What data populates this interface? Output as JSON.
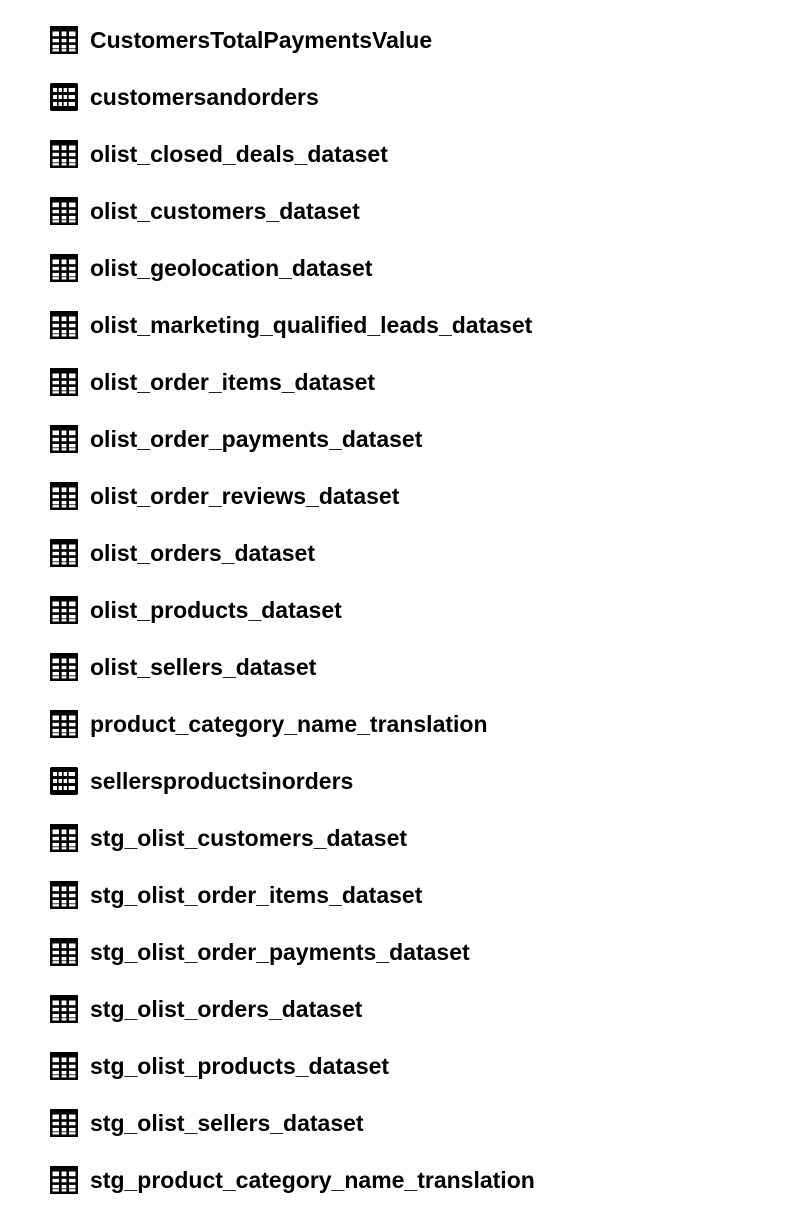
{
  "resources": [
    {
      "label": "CustomersTotalPaymentsValue",
      "icon": "table-icon",
      "type": "table"
    },
    {
      "label": "customersandorders",
      "icon": "view-icon",
      "type": "view"
    },
    {
      "label": "olist_closed_deals_dataset",
      "icon": "table-icon",
      "type": "table"
    },
    {
      "label": "olist_customers_dataset",
      "icon": "table-icon",
      "type": "table"
    },
    {
      "label": "olist_geolocation_dataset",
      "icon": "table-icon",
      "type": "table"
    },
    {
      "label": "olist_marketing_qualified_leads_dataset",
      "icon": "table-icon",
      "type": "table"
    },
    {
      "label": "olist_order_items_dataset",
      "icon": "table-icon",
      "type": "table"
    },
    {
      "label": "olist_order_payments_dataset",
      "icon": "table-icon",
      "type": "table"
    },
    {
      "label": "olist_order_reviews_dataset",
      "icon": "table-icon",
      "type": "table"
    },
    {
      "label": "olist_orders_dataset",
      "icon": "table-icon",
      "type": "table"
    },
    {
      "label": "olist_products_dataset",
      "icon": "table-icon",
      "type": "table"
    },
    {
      "label": "olist_sellers_dataset",
      "icon": "table-icon",
      "type": "table"
    },
    {
      "label": "product_category_name_translation",
      "icon": "table-icon",
      "type": "table"
    },
    {
      "label": "sellersproductsinorders",
      "icon": "view-icon",
      "type": "view"
    },
    {
      "label": "stg_olist_customers_dataset",
      "icon": "table-icon",
      "type": "table"
    },
    {
      "label": "stg_olist_order_items_dataset",
      "icon": "table-icon",
      "type": "table"
    },
    {
      "label": "stg_olist_order_payments_dataset",
      "icon": "table-icon",
      "type": "table"
    },
    {
      "label": "stg_olist_orders_dataset",
      "icon": "table-icon",
      "type": "table"
    },
    {
      "label": "stg_olist_products_dataset",
      "icon": "table-icon",
      "type": "table"
    },
    {
      "label": "stg_olist_sellers_dataset",
      "icon": "table-icon",
      "type": "table"
    },
    {
      "label": "stg_product_category_name_translation",
      "icon": "table-icon",
      "type": "table"
    }
  ],
  "colors": {
    "text": "#000000",
    "icon": "#000000",
    "background": "#ffffff"
  }
}
